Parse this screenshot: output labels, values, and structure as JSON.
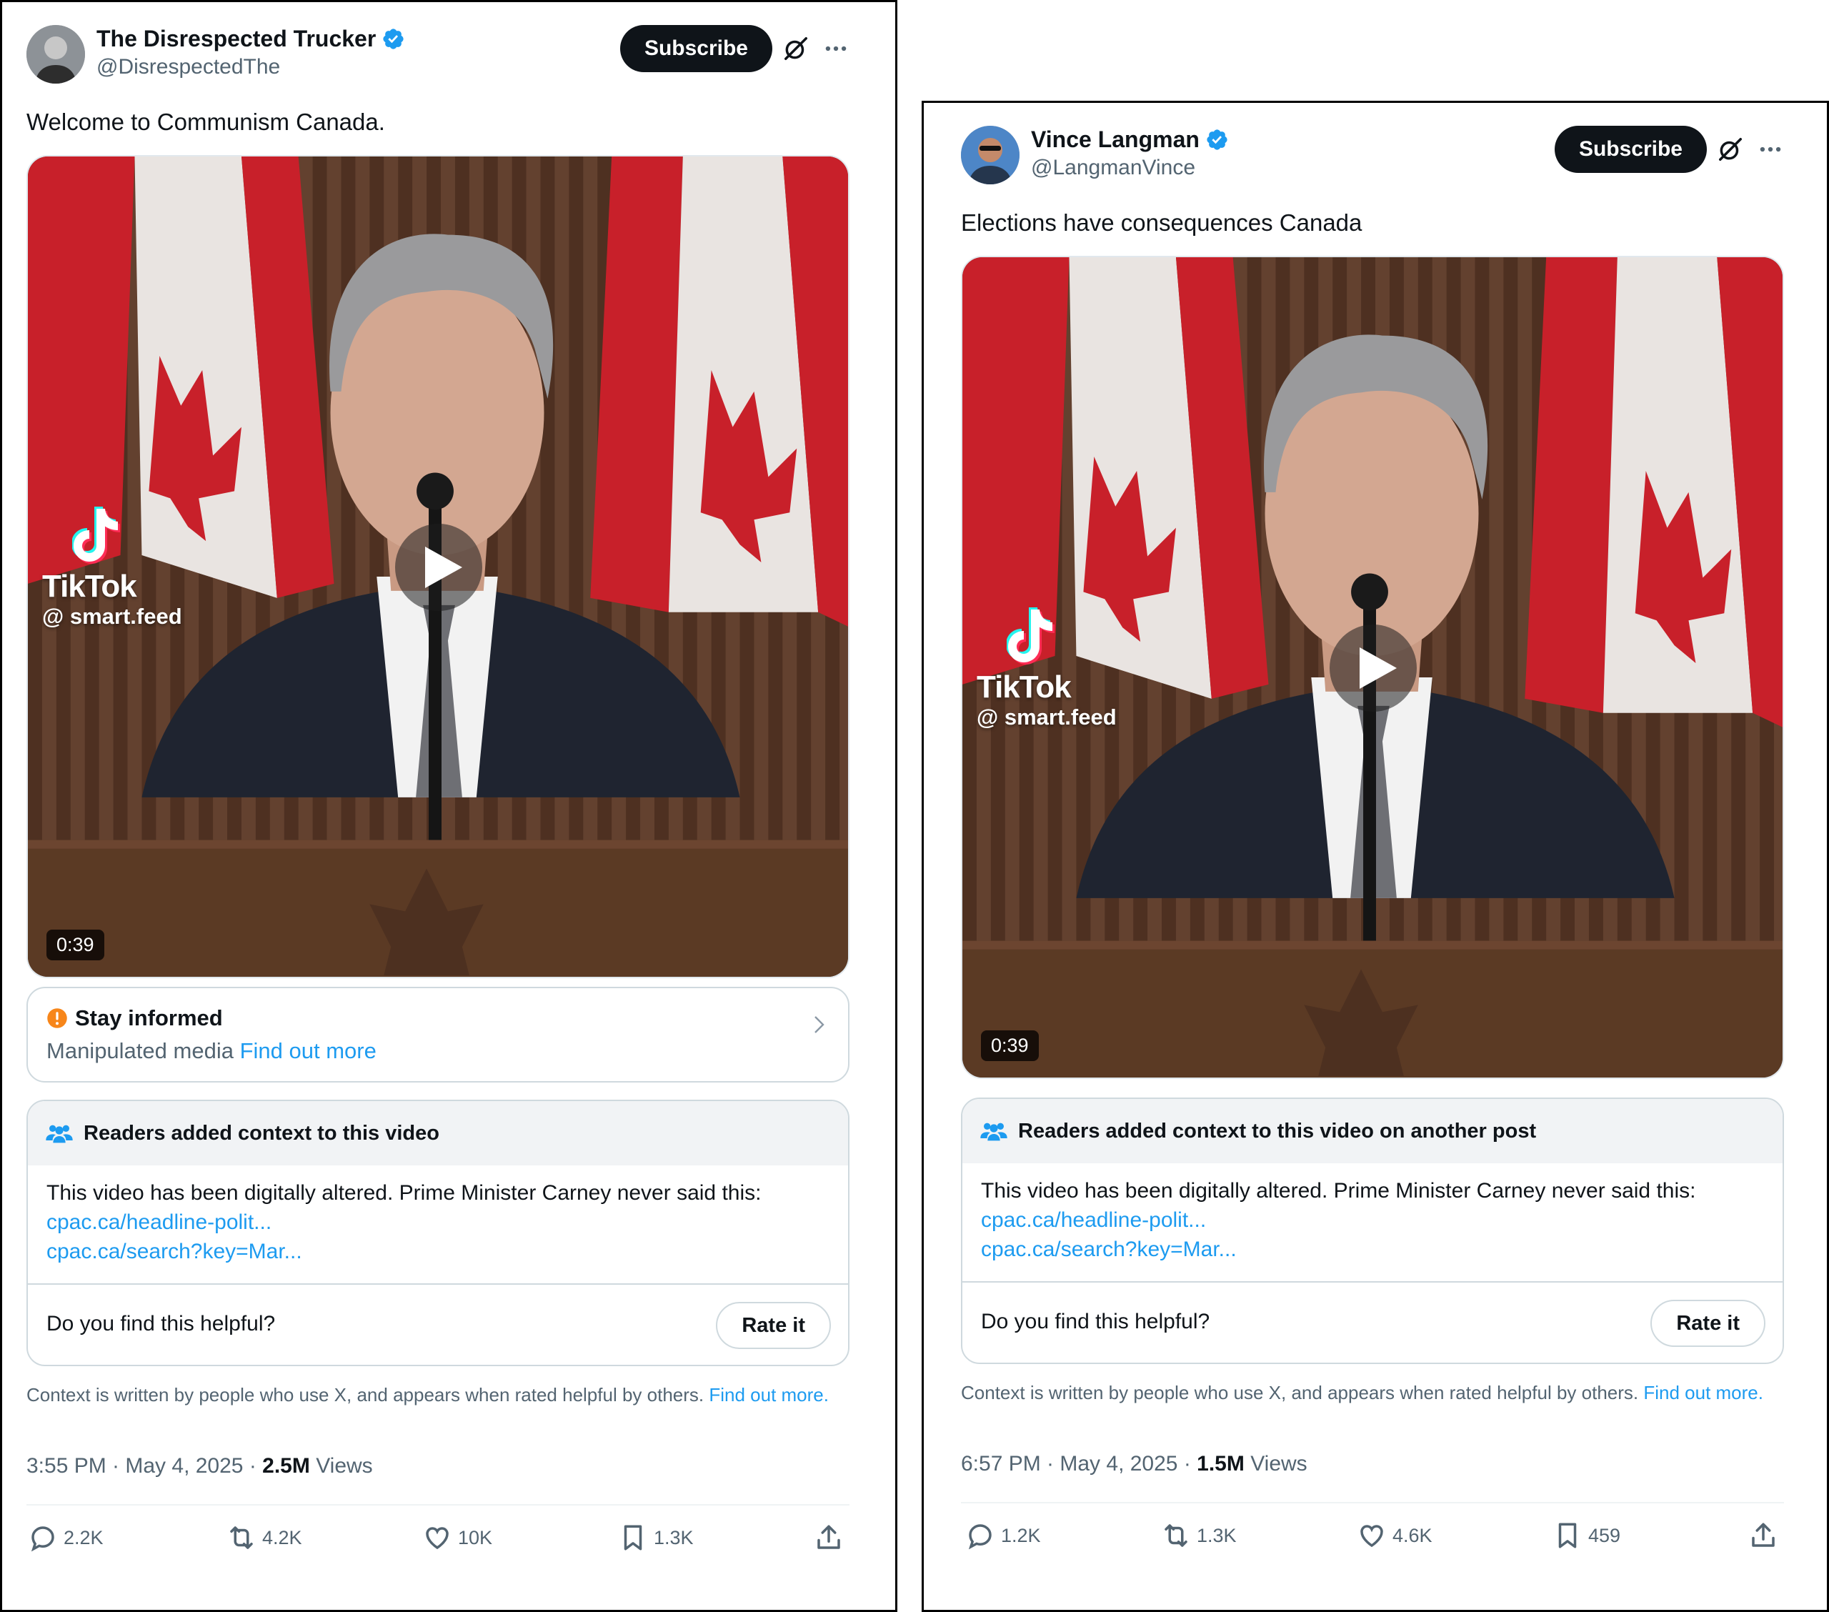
{
  "colors": {
    "accent": "#1d9bf0",
    "text": "#0f1419",
    "muted": "#536471",
    "warning": "#f7861a"
  },
  "posts": [
    {
      "author": {
        "name": "The Disrespected Trucker",
        "handle": "@DisrespectedThe",
        "verified_icon": "verified-badge-icon"
      },
      "subscribe_label": "Subscribe",
      "text": "Welcome to Communism Canada.",
      "video": {
        "tiktok_name": "TikTok",
        "tiktok_handle": "@ smart.feed",
        "duration": "0:39"
      },
      "stay_informed": {
        "title": "Stay informed",
        "label": "Manipulated media",
        "link": "Find out more"
      },
      "notes": {
        "header": "Readers added context to this video",
        "body": "This video has been digitally altered. Prime Minister Carney never said this:",
        "links": [
          "cpac.ca/headline-polit...",
          "cpac.ca/search?key=Mar..."
        ],
        "helpful_question": "Do you find this helpful?",
        "rate_label": "Rate it"
      },
      "context_note": "Context is written by people who use X, and appears when rated helpful by others.",
      "context_link": "Find out more.",
      "meta": {
        "time": "3:55 PM · May 4, 2025 · ",
        "views_count": "2.5M",
        "views_label": " Views"
      },
      "stats": {
        "replies": "2.2K",
        "reposts": "4.2K",
        "likes": "10K",
        "bookmarks": "1.3K"
      }
    },
    {
      "author": {
        "name": "Vince Langman",
        "handle": "@LangmanVince",
        "verified_icon": "verified-badge-icon"
      },
      "subscribe_label": "Subscribe",
      "text": "Elections have consequences Canada",
      "video": {
        "tiktok_name": "TikTok",
        "tiktok_handle": "@ smart.feed",
        "duration": "0:39"
      },
      "notes": {
        "header": "Readers added context to this video on another post",
        "body": "This video has been digitally altered. Prime Minister Carney never said this:",
        "links": [
          "cpac.ca/headline-polit...",
          "cpac.ca/search?key=Mar..."
        ],
        "helpful_question": "Do you find this helpful?",
        "rate_label": "Rate it"
      },
      "context_note": "Context is written by people who use X, and appears when rated helpful by others.",
      "context_link": "Find out more.",
      "meta": {
        "time": "6:57 PM · May 4, 2025 · ",
        "views_count": "1.5M",
        "views_label": " Views"
      },
      "stats": {
        "replies": "1.2K",
        "reposts": "1.3K",
        "likes": "4.6K",
        "bookmarks": "459"
      }
    }
  ]
}
